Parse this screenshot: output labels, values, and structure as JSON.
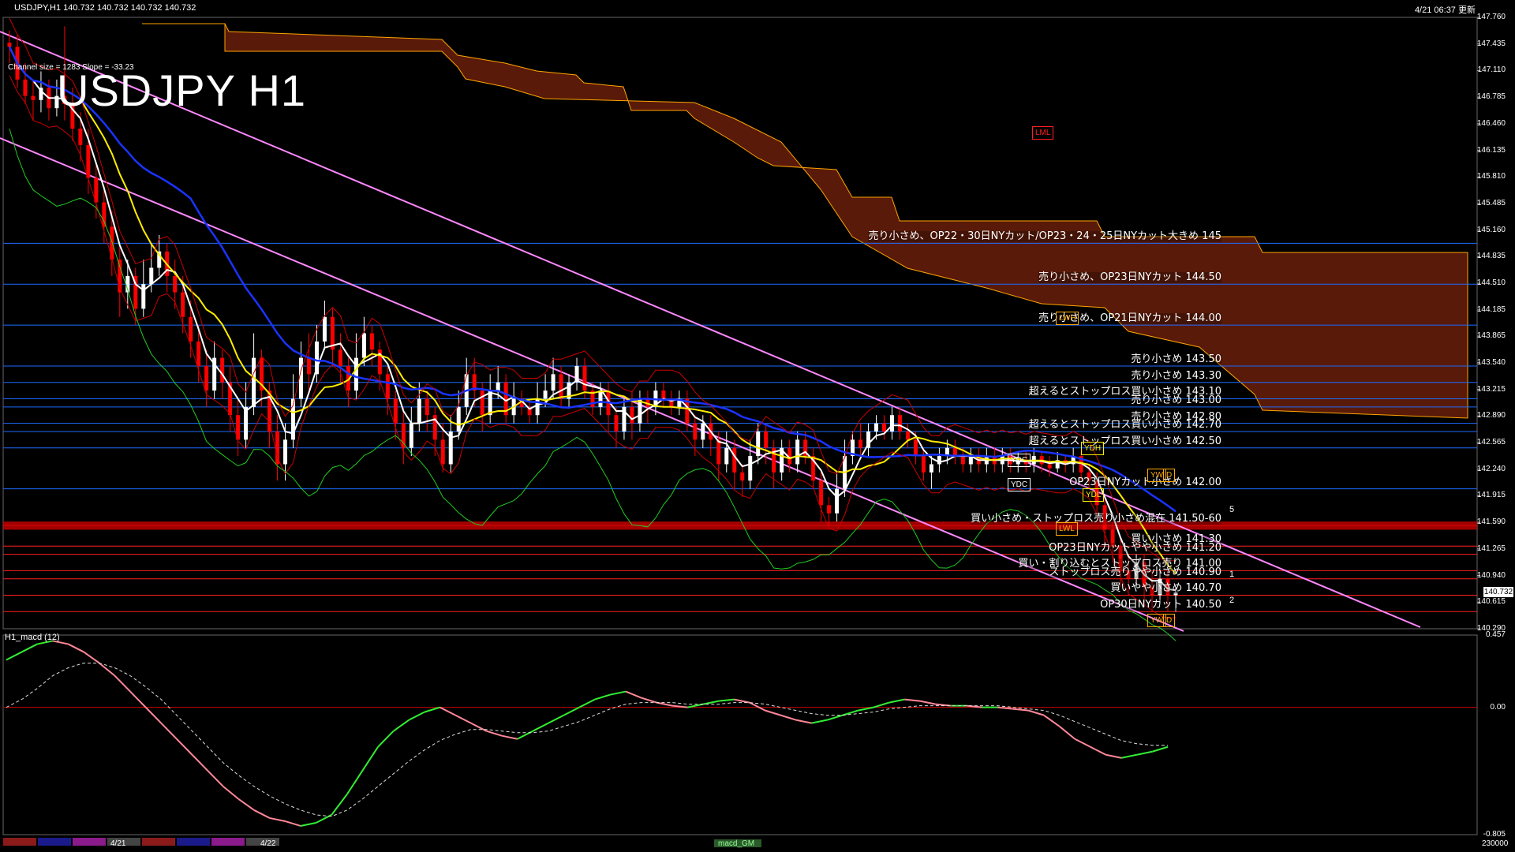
{
  "header": {
    "symbol_line": "USDJPY,H1  140.732 140.732 140.732 140.732",
    "datetime": "4/21 06:37 更新",
    "big_title": "USDJPY H1",
    "channel_info": "Channel size = 1283 Slope = -33.23"
  },
  "subwindow": {
    "title": "H1_macd (12)",
    "ticks": [
      "0.457",
      "0.00",
      "-0.805"
    ],
    "max": 0.457,
    "min": -0.805
  },
  "price_axis": {
    "ticks": [
      "147.760",
      "147.435",
      "147.110",
      "146.785",
      "146.460",
      "146.135",
      "145.810",
      "145.485",
      "145.160",
      "144.835",
      "144.510",
      "144.185",
      "143.865",
      "143.540",
      "143.215",
      "142.890",
      "142.565",
      "142.240",
      "141.915",
      "141.590",
      "141.265",
      "140.940",
      "140.615",
      "140.290"
    ],
    "max": 147.76,
    "min": 140.29,
    "current_price": "140.732"
  },
  "bottom_bar": {
    "dates": [
      "4/21",
      "4/22"
    ],
    "right_value": "230000",
    "indicator_name": "macd_GM"
  },
  "colors": {
    "bull_candle": "#ffffff",
    "bear_candle": "#ff0000",
    "blue_level": "#1e6bff",
    "red_level": "#ff2020",
    "cloud": "#ff4a1a",
    "channel": "#ff88ff",
    "ma_fast": "#ffffff",
    "ma_mid": "#ffee00",
    "ma_slow": "#1a33ff",
    "band": "#cc0000",
    "green_line": "#22cc22",
    "macd_bull": "#33ee33",
    "macd_bear": "#ff8899"
  },
  "tags": [
    {
      "text": "LML",
      "color": "#ff2020"
    },
    {
      "text": "LWH",
      "color": "#ffaa00"
    },
    {
      "text": "YDH",
      "color": "#ffee00"
    },
    {
      "text": "YDC",
      "color": "#ffffff"
    },
    {
      "text": "YDC",
      "color": "#ffffff"
    },
    {
      "text": "YDL",
      "color": "#ffee00"
    },
    {
      "text": "LWL",
      "color": "#ffaa00"
    },
    {
      "text": "YW",
      "color": "#ffaa00"
    },
    {
      "text": "D",
      "color": "#ffaa00"
    },
    {
      "text": "YW",
      "color": "#ffaa00"
    },
    {
      "text": "D",
      "color": "#ffaa00"
    }
  ],
  "wave_labels": [
    "5",
    "1",
    "2"
  ],
  "chart_data": {
    "type": "candlestick",
    "ylim": [
      140.29,
      147.76
    ],
    "levels": [
      {
        "price": 145.0,
        "color": "blue",
        "label": "売り小さめ、OP22・30日NYカット/OP23・24・25日NYカット大きめ 145"
      },
      {
        "price": 144.5,
        "color": "blue",
        "label": "売り小さめ、OP23日NYカット 144.50"
      },
      {
        "price": 144.0,
        "color": "blue",
        "label": "売り小さめ、OP21日NYカット 144.00"
      },
      {
        "price": 143.5,
        "color": "blue",
        "label": "売り小さめ 143.50"
      },
      {
        "price": 143.3,
        "color": "blue",
        "label": "売り小さめ 143.30"
      },
      {
        "price": 143.1,
        "color": "blue",
        "label": "超えるとストップロス買い小さめ 143.10"
      },
      {
        "price": 143.0,
        "color": "blue",
        "label": "売り小さめ 143.00"
      },
      {
        "price": 142.8,
        "color": "blue",
        "label": "売り小さめ 142.80"
      },
      {
        "price": 142.7,
        "color": "blue",
        "label": "超えるとストップロス買い小さめ 142.70"
      },
      {
        "price": 142.5,
        "color": "blue",
        "label": "超えるとストップロス買い小さめ 142.50"
      },
      {
        "price": 142.0,
        "color": "blue",
        "label": "OP23日NYカット小さめ 142.00"
      },
      {
        "price": 141.55,
        "color": "red",
        "label": "買い小さめ・ストップロス売り小さめ混在 141.50-60"
      },
      {
        "price": 141.3,
        "color": "red",
        "label": "買い小さめ 141.30"
      },
      {
        "price": 141.2,
        "color": "red",
        "label": "OP23日NYカットやや小さめ 141.20"
      },
      {
        "price": 141.0,
        "color": "red",
        "label": "買い・割り込むとストップロス売り 141.00"
      },
      {
        "price": 140.9,
        "color": "red",
        "label": "ストップロス売りやや小さめ 140.90"
      },
      {
        "price": 140.7,
        "color": "red",
        "label": "買いやや小さめ 140.70"
      },
      {
        "price": 140.5,
        "color": "red",
        "label": "OP30日NYカット 140.50"
      }
    ],
    "candles": [
      [
        147.45,
        147.4,
        147.6,
        147.2
      ],
      [
        147.4,
        147.0,
        147.55,
        146.9
      ],
      [
        147.0,
        146.8,
        147.2,
        146.7
      ],
      [
        146.8,
        146.75,
        147.0,
        146.5
      ],
      [
        146.75,
        146.9,
        147.1,
        146.6
      ],
      [
        146.9,
        146.65,
        147.0,
        146.5
      ],
      [
        146.65,
        146.8,
        147.0,
        146.55
      ],
      [
        146.8,
        146.7,
        147.65,
        146.5
      ],
      [
        146.7,
        146.4,
        146.9,
        146.25
      ],
      [
        146.4,
        146.2,
        146.6,
        146.0
      ],
      [
        146.2,
        145.8,
        146.4,
        145.6
      ],
      [
        145.8,
        145.5,
        146.0,
        145.3
      ],
      [
        145.5,
        145.2,
        145.7,
        145.0
      ],
      [
        145.2,
        144.8,
        145.4,
        144.6
      ],
      [
        144.8,
        144.4,
        145.0,
        144.1
      ],
      [
        144.4,
        144.6,
        144.8,
        144.2
      ],
      [
        144.6,
        144.2,
        144.7,
        144.0
      ],
      [
        144.2,
        144.5,
        144.8,
        144.1
      ],
      [
        144.5,
        144.7,
        145.0,
        144.4
      ],
      [
        144.7,
        144.9,
        145.1,
        144.6
      ],
      [
        144.9,
        144.6,
        145.0,
        144.4
      ],
      [
        144.6,
        144.4,
        144.8,
        144.2
      ],
      [
        144.4,
        144.1,
        144.6,
        143.9
      ],
      [
        144.1,
        143.8,
        144.3,
        143.6
      ],
      [
        143.8,
        143.5,
        144.0,
        143.3
      ],
      [
        143.5,
        143.2,
        143.7,
        143.0
      ],
      [
        143.2,
        143.6,
        143.8,
        143.1
      ],
      [
        143.6,
        143.3,
        143.7,
        143.1
      ],
      [
        143.3,
        142.9,
        143.5,
        142.7
      ],
      [
        142.9,
        142.6,
        143.1,
        142.4
      ],
      [
        142.6,
        143.0,
        143.3,
        142.5
      ],
      [
        143.0,
        143.6,
        143.9,
        142.9
      ],
      [
        143.6,
        143.2,
        143.7,
        143.0
      ],
      [
        143.2,
        142.7,
        143.3,
        142.5
      ],
      [
        142.7,
        142.3,
        142.9,
        142.1
      ],
      [
        142.3,
        142.6,
        142.8,
        142.1
      ],
      [
        142.6,
        143.1,
        143.4,
        142.5
      ],
      [
        143.1,
        143.6,
        143.8,
        143.0
      ],
      [
        143.6,
        143.4,
        143.9,
        143.2
      ],
      [
        143.4,
        143.8,
        144.0,
        143.3
      ],
      [
        143.8,
        144.1,
        144.3,
        143.7
      ],
      [
        144.1,
        143.7,
        144.2,
        143.5
      ],
      [
        143.7,
        143.5,
        143.9,
        143.3
      ],
      [
        143.5,
        143.2,
        143.6,
        143.0
      ],
      [
        143.2,
        143.6,
        143.9,
        143.1
      ],
      [
        143.6,
        143.9,
        144.1,
        143.5
      ],
      [
        143.9,
        143.7,
        144.0,
        143.5
      ],
      [
        143.7,
        143.4,
        143.8,
        143.2
      ],
      [
        143.4,
        143.1,
        143.5,
        142.9
      ],
      [
        143.1,
        142.8,
        143.2,
        142.6
      ],
      [
        142.8,
        142.5,
        143.0,
        142.3
      ],
      [
        142.5,
        142.8,
        143.0,
        142.4
      ],
      [
        142.8,
        143.1,
        143.3,
        142.7
      ],
      [
        143.1,
        142.9,
        143.2,
        142.7
      ],
      [
        142.9,
        142.6,
        143.0,
        142.4
      ],
      [
        142.6,
        142.3,
        142.8,
        142.2
      ],
      [
        142.3,
        142.7,
        142.9,
        142.2
      ],
      [
        142.7,
        143.0,
        143.2,
        142.6
      ],
      [
        143.0,
        143.4,
        143.6,
        142.9
      ],
      [
        143.4,
        143.2,
        143.6,
        143.0
      ],
      [
        143.2,
        142.9,
        143.3,
        142.7
      ],
      [
        142.9,
        143.2,
        143.4,
        142.8
      ],
      [
        143.2,
        143.3,
        143.5,
        143.1
      ],
      [
        143.3,
        142.9,
        143.4,
        142.8
      ],
      [
        142.9,
        143.1,
        143.3,
        142.8
      ],
      [
        143.1,
        143.0,
        143.2,
        142.9
      ],
      [
        143.0,
        142.9,
        143.1,
        142.8
      ],
      [
        142.9,
        143.1,
        143.3,
        142.8
      ],
      [
        143.1,
        143.2,
        143.4,
        143.0
      ],
      [
        143.2,
        143.4,
        143.6,
        143.1
      ],
      [
        143.4,
        143.1,
        143.5,
        143.0
      ],
      [
        143.1,
        143.3,
        143.4,
        143.0
      ],
      [
        143.3,
        143.5,
        143.6,
        143.2
      ],
      [
        143.5,
        143.2,
        143.6,
        143.1
      ],
      [
        143.2,
        143.0,
        143.3,
        142.9
      ],
      [
        143.0,
        143.2,
        143.3,
        142.9
      ],
      [
        143.2,
        142.9,
        143.3,
        142.7
      ],
      [
        142.9,
        142.7,
        143.0,
        142.5
      ],
      [
        142.7,
        143.0,
        143.1,
        142.6
      ],
      [
        143.0,
        142.8,
        143.2,
        142.6
      ],
      [
        142.8,
        143.1,
        143.2,
        142.7
      ],
      [
        143.1,
        143.0,
        143.2,
        142.8
      ],
      [
        143.0,
        143.2,
        143.3,
        142.9
      ],
      [
        143.2,
        143.1,
        143.3,
        143.0
      ],
      [
        143.1,
        143.0,
        143.2,
        142.9
      ],
      [
        143.0,
        143.1,
        143.2,
        142.9
      ],
      [
        143.1,
        142.8,
        143.2,
        142.7
      ],
      [
        142.8,
        142.6,
        142.9,
        142.4
      ],
      [
        142.6,
        142.8,
        142.9,
        142.5
      ],
      [
        142.8,
        142.6,
        142.9,
        142.4
      ],
      [
        142.6,
        142.3,
        142.7,
        142.1
      ],
      [
        142.3,
        142.5,
        142.7,
        142.2
      ],
      [
        142.5,
        142.2,
        142.6,
        142.0
      ],
      [
        142.2,
        142.1,
        142.3,
        141.9
      ],
      [
        142.1,
        142.4,
        142.6,
        142.0
      ],
      [
        142.4,
        142.7,
        142.8,
        142.3
      ],
      [
        142.7,
        142.5,
        142.8,
        142.3
      ],
      [
        142.5,
        142.2,
        142.6,
        142.0
      ],
      [
        142.2,
        142.5,
        142.6,
        142.1
      ],
      [
        142.5,
        142.3,
        142.6,
        142.2
      ],
      [
        142.3,
        142.6,
        142.7,
        142.2
      ],
      [
        142.6,
        142.4,
        142.7,
        142.3
      ],
      [
        142.4,
        142.1,
        142.5,
        142.0
      ],
      [
        142.1,
        141.8,
        142.2,
        141.6
      ],
      [
        141.8,
        141.7,
        141.9,
        141.55
      ],
      [
        141.7,
        142.0,
        142.2,
        141.6
      ],
      [
        142.0,
        142.4,
        142.6,
        141.9
      ],
      [
        142.4,
        142.6,
        142.7,
        142.3
      ],
      [
        142.6,
        142.5,
        142.8,
        142.4
      ],
      [
        142.5,
        142.7,
        142.8,
        142.4
      ],
      [
        142.7,
        142.8,
        142.9,
        142.6
      ],
      [
        142.8,
        142.7,
        142.9,
        142.6
      ],
      [
        142.7,
        142.9,
        143.0,
        142.6
      ],
      [
        142.9,
        142.7,
        143.0,
        142.6
      ],
      [
        142.7,
        142.6,
        142.8,
        142.5
      ],
      [
        142.6,
        142.4,
        142.7,
        142.3
      ],
      [
        142.4,
        142.2,
        142.5,
        142.1
      ],
      [
        142.2,
        142.3,
        142.4,
        142.0
      ],
      [
        142.3,
        142.4,
        142.5,
        142.2
      ],
      [
        142.4,
        142.5,
        142.6,
        142.3
      ],
      [
        142.5,
        142.4,
        142.6,
        142.3
      ],
      [
        142.4,
        142.3,
        142.5,
        142.2
      ],
      [
        142.3,
        142.4,
        142.5,
        142.2
      ],
      [
        142.4,
        142.3,
        142.5,
        142.2
      ],
      [
        142.3,
        142.4,
        142.5,
        142.2
      ],
      [
        142.4,
        142.3,
        142.5,
        142.2
      ],
      [
        142.3,
        142.4,
        142.5,
        142.2
      ],
      [
        142.4,
        142.3,
        142.5,
        142.2
      ],
      [
        142.3,
        142.35,
        142.45,
        142.2
      ],
      [
        142.35,
        142.3,
        142.45,
        142.2
      ],
      [
        142.3,
        142.4,
        142.5,
        142.2
      ],
      [
        142.4,
        142.3,
        142.45,
        142.2
      ],
      [
        142.3,
        142.25,
        142.4,
        142.15
      ],
      [
        142.25,
        142.35,
        142.45,
        142.2
      ],
      [
        142.35,
        142.3,
        142.4,
        142.2
      ],
      [
        142.3,
        142.4,
        142.5,
        142.2
      ],
      [
        142.4,
        142.2,
        142.45,
        142.1
      ],
      [
        142.2,
        142.1,
        142.3,
        142.0
      ],
      [
        142.1,
        141.8,
        142.2,
        141.7
      ],
      [
        141.8,
        141.5,
        141.9,
        141.3
      ],
      [
        141.5,
        141.3,
        141.6,
        141.1
      ],
      [
        141.3,
        141.0,
        141.4,
        140.8
      ],
      [
        141.0,
        140.9,
        141.2,
        140.7
      ],
      [
        140.9,
        141.1,
        141.2,
        140.8
      ],
      [
        141.1,
        140.8,
        141.2,
        140.6
      ],
      [
        140.8,
        140.7,
        141.0,
        140.5
      ],
      [
        140.7,
        140.9,
        141.1,
        140.6
      ],
      [
        140.9,
        140.7,
        141.0,
        140.5
      ],
      [
        140.7,
        140.732,
        140.8,
        140.5
      ]
    ],
    "macd": [
      0.3,
      0.35,
      0.4,
      0.42,
      0.4,
      0.35,
      0.28,
      0.2,
      0.1,
      0.0,
      -0.1,
      -0.2,
      -0.3,
      -0.4,
      -0.5,
      -0.58,
      -0.65,
      -0.7,
      -0.72,
      -0.75,
      -0.73,
      -0.68,
      -0.55,
      -0.4,
      -0.25,
      -0.15,
      -0.08,
      -0.03,
      0.0,
      -0.05,
      -0.1,
      -0.15,
      -0.18,
      -0.2,
      -0.15,
      -0.1,
      -0.05,
      0.0,
      0.05,
      0.08,
      0.1,
      0.06,
      0.03,
      0.01,
      0.0,
      0.02,
      0.04,
      0.05,
      0.03,
      -0.02,
      -0.05,
      -0.08,
      -0.1,
      -0.08,
      -0.05,
      -0.02,
      0.0,
      0.03,
      0.05,
      0.04,
      0.02,
      0.01,
      0.01,
      0.0,
      0.0,
      -0.01,
      -0.02,
      -0.05,
      -0.12,
      -0.2,
      -0.25,
      -0.3,
      -0.32,
      -0.3,
      -0.28,
      -0.25
    ],
    "signal": [
      0.0,
      0.05,
      0.12,
      0.2,
      0.25,
      0.28,
      0.28,
      0.25,
      0.2,
      0.13,
      0.05,
      -0.05,
      -0.15,
      -0.25,
      -0.35,
      -0.43,
      -0.5,
      -0.56,
      -0.61,
      -0.65,
      -0.68,
      -0.69,
      -0.65,
      -0.58,
      -0.5,
      -0.42,
      -0.34,
      -0.27,
      -0.21,
      -0.17,
      -0.14,
      -0.14,
      -0.15,
      -0.16,
      -0.16,
      -0.15,
      -0.12,
      -0.09,
      -0.05,
      -0.01,
      0.02,
      0.03,
      0.03,
      0.03,
      0.02,
      0.02,
      0.02,
      0.03,
      0.03,
      0.02,
      0.0,
      -0.02,
      -0.04,
      -0.05,
      -0.05,
      -0.04,
      -0.03,
      -0.01,
      0.0,
      0.01,
      0.01,
      0.01,
      0.01,
      0.01,
      0.01,
      0.0,
      -0.01,
      -0.02,
      -0.05,
      -0.09,
      -0.13,
      -0.17,
      -0.21,
      -0.23,
      -0.24,
      -0.24
    ]
  }
}
